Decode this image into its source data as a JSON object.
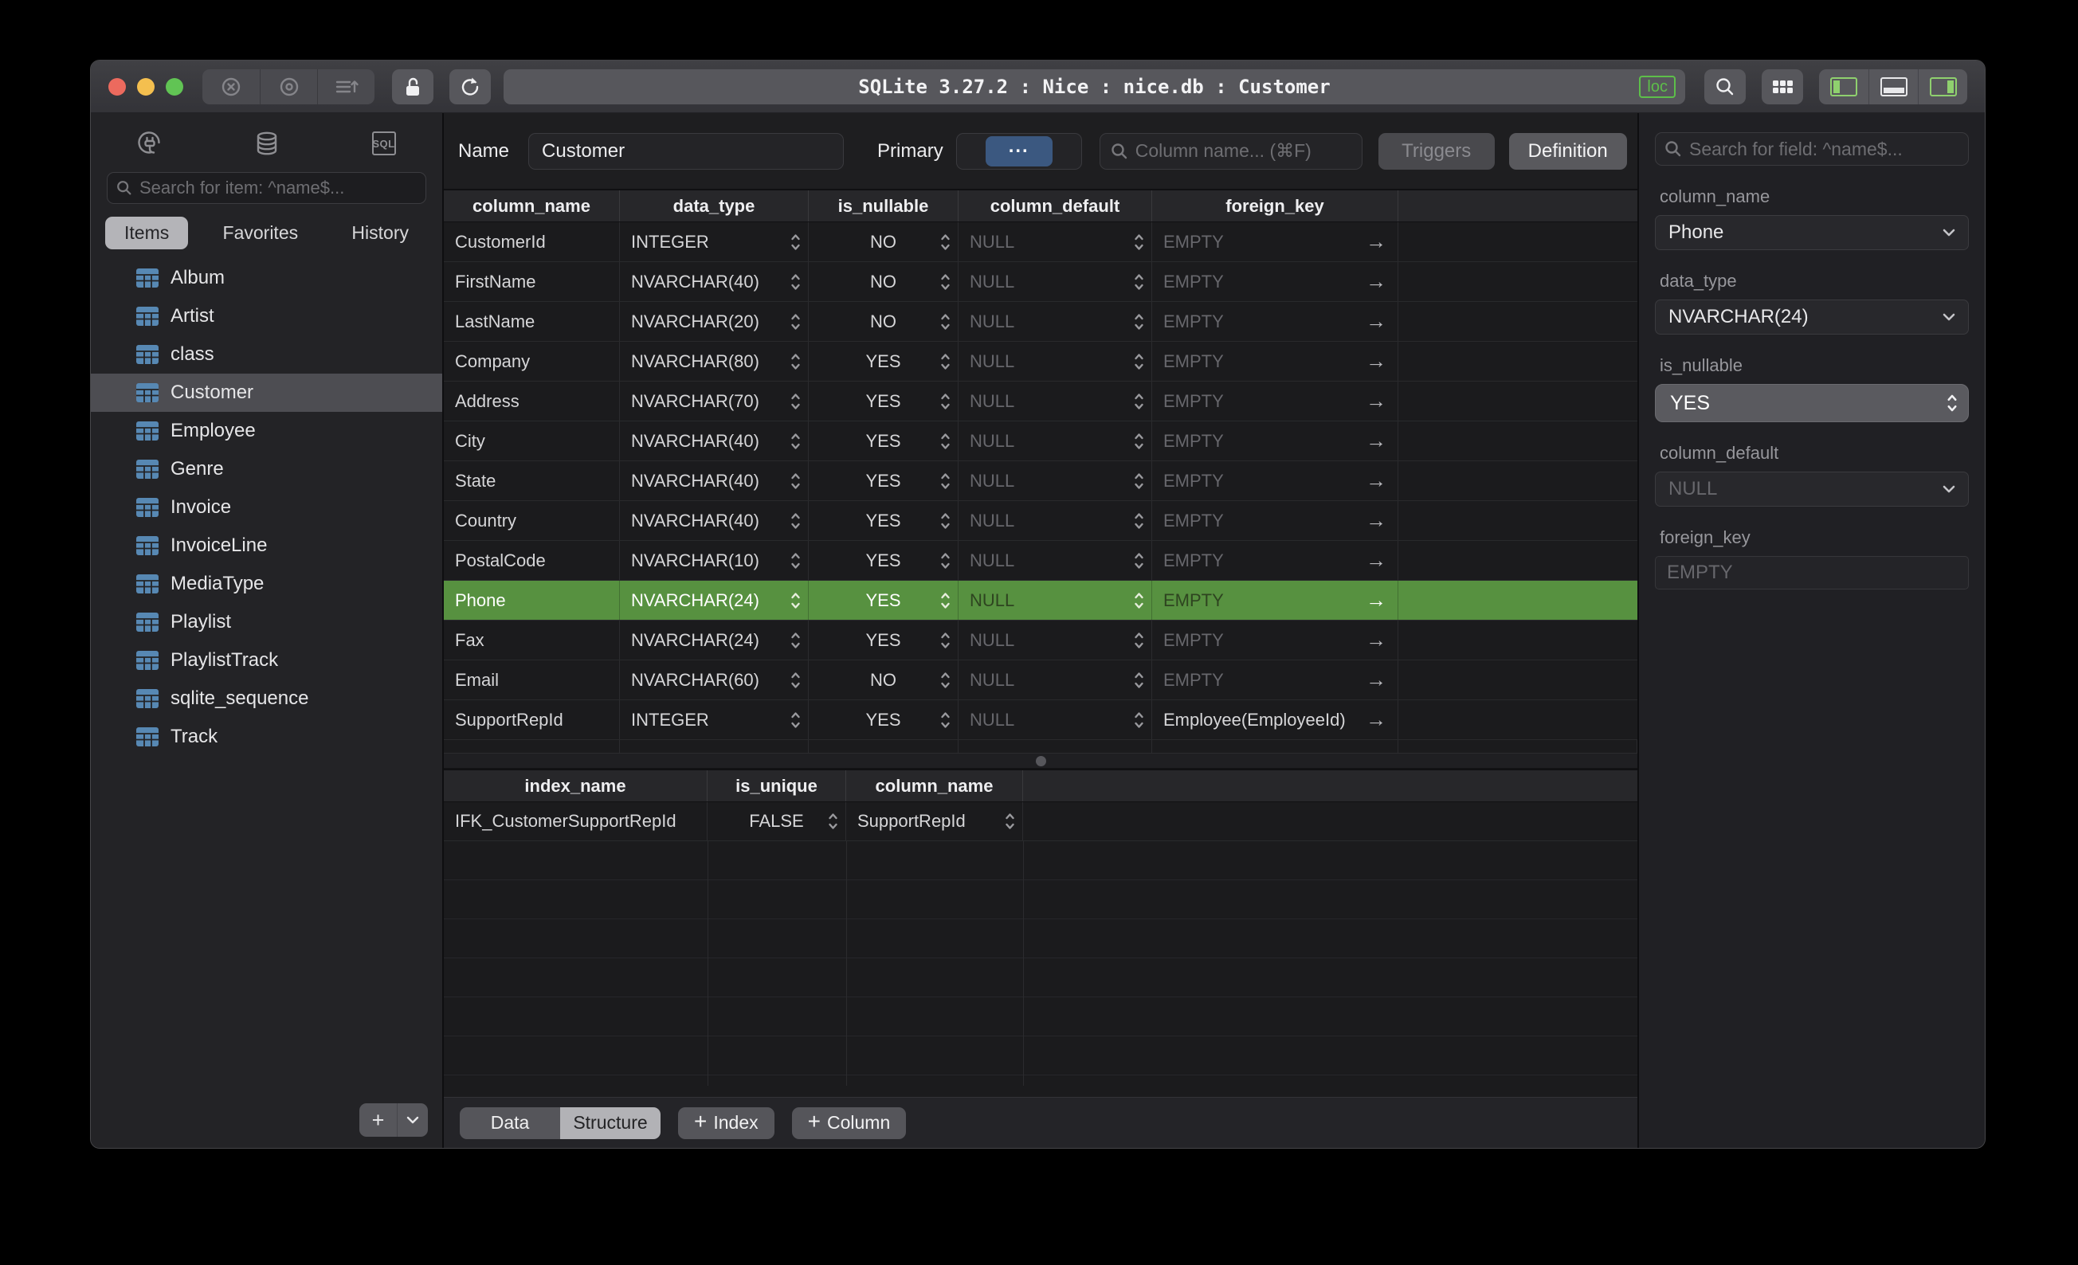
{
  "window": {
    "title": "SQLite 3.27.2 : Nice : nice.db : Customer",
    "loc_badge": "loc"
  },
  "icons": {
    "arrow_right": "→",
    "plus_glyph": "+",
    "ellipsis": "...",
    "sql_text": "SQL"
  },
  "colors": {
    "highlight_green": "#579140",
    "traffic_red": "#ec6a5e",
    "traffic_yellow": "#f4bf4f",
    "traffic_green": "#61c454",
    "table_icon_blue": "#5788b3",
    "loc_badge_green": "#5dbf4a",
    "panel_toggle_green": "#8fd06e",
    "primary_button_blue": "#3b5880"
  },
  "sidebar": {
    "search_placeholder": "Search for item: ^name$...",
    "tabs": [
      {
        "label": "Items",
        "active": true
      },
      {
        "label": "Favorites"
      },
      {
        "label": "History"
      }
    ],
    "items": [
      {
        "label": "Album"
      },
      {
        "label": "Artist"
      },
      {
        "label": "class"
      },
      {
        "label": "Customer",
        "selected": true
      },
      {
        "label": "Employee"
      },
      {
        "label": "Genre"
      },
      {
        "label": "Invoice"
      },
      {
        "label": "InvoiceLine"
      },
      {
        "label": "MediaType"
      },
      {
        "label": "Playlist"
      },
      {
        "label": "PlaylistTrack"
      },
      {
        "label": "sqlite_sequence"
      },
      {
        "label": "Track"
      }
    ]
  },
  "header": {
    "name_label": "Name",
    "name_value": "Customer",
    "primary_label": "Primary",
    "primary_button": "...",
    "search_placeholder": "Column name... (⌘F)",
    "triggers_label": "Triggers",
    "definition_label": "Definition"
  },
  "structure": {
    "columns": [
      "column_name",
      "data_type",
      "is_nullable",
      "column_default",
      "foreign_key"
    ],
    "rows": [
      {
        "column_name": "CustomerId",
        "data_type": "INTEGER",
        "is_nullable": "NO",
        "column_default": "NULL",
        "foreign_key": "EMPTY"
      },
      {
        "column_name": "FirstName",
        "data_type": "NVARCHAR(40)",
        "is_nullable": "NO",
        "column_default": "NULL",
        "foreign_key": "EMPTY"
      },
      {
        "column_name": "LastName",
        "data_type": "NVARCHAR(20)",
        "is_nullable": "NO",
        "column_default": "NULL",
        "foreign_key": "EMPTY"
      },
      {
        "column_name": "Company",
        "data_type": "NVARCHAR(80)",
        "is_nullable": "YES",
        "column_default": "NULL",
        "foreign_key": "EMPTY"
      },
      {
        "column_name": "Address",
        "data_type": "NVARCHAR(70)",
        "is_nullable": "YES",
        "column_default": "NULL",
        "foreign_key": "EMPTY"
      },
      {
        "column_name": "City",
        "data_type": "NVARCHAR(40)",
        "is_nullable": "YES",
        "column_default": "NULL",
        "foreign_key": "EMPTY"
      },
      {
        "column_name": "State",
        "data_type": "NVARCHAR(40)",
        "is_nullable": "YES",
        "column_default": "NULL",
        "foreign_key": "EMPTY"
      },
      {
        "column_name": "Country",
        "data_type": "NVARCHAR(40)",
        "is_nullable": "YES",
        "column_default": "NULL",
        "foreign_key": "EMPTY"
      },
      {
        "column_name": "PostalCode",
        "data_type": "NVARCHAR(10)",
        "is_nullable": "YES",
        "column_default": "NULL",
        "foreign_key": "EMPTY"
      },
      {
        "column_name": "Phone",
        "data_type": "NVARCHAR(24)",
        "is_nullable": "YES",
        "column_default": "NULL",
        "foreign_key": "EMPTY",
        "highlight": true
      },
      {
        "column_name": "Fax",
        "data_type": "NVARCHAR(24)",
        "is_nullable": "YES",
        "column_default": "NULL",
        "foreign_key": "EMPTY"
      },
      {
        "column_name": "Email",
        "data_type": "NVARCHAR(60)",
        "is_nullable": "NO",
        "column_default": "NULL",
        "foreign_key": "EMPTY"
      },
      {
        "column_name": "SupportRepId",
        "data_type": "INTEGER",
        "is_nullable": "YES",
        "column_default": "NULL",
        "foreign_key": "Employee(EmployeeId)"
      }
    ]
  },
  "indexes": {
    "columns": [
      "index_name",
      "is_unique",
      "column_name"
    ],
    "rows": [
      {
        "index_name": "IFK_CustomerSupportRepId",
        "is_unique": "FALSE",
        "column_name": "SupportRepId"
      }
    ]
  },
  "footer": {
    "tabs": [
      {
        "label": "Data"
      },
      {
        "label": "Structure",
        "active": true
      }
    ],
    "add_index_label": "Index",
    "add_column_label": "Column"
  },
  "inspector": {
    "search_placeholder": "Search for field: ^name$...",
    "fields": [
      {
        "label": "column_name",
        "value": "Phone"
      },
      {
        "label": "data_type",
        "value": "NVARCHAR(24)"
      },
      {
        "label": "is_nullable",
        "value": "YES"
      },
      {
        "label": "column_default",
        "value": "NULL"
      },
      {
        "label": "foreign_key",
        "value": "EMPTY"
      }
    ]
  }
}
